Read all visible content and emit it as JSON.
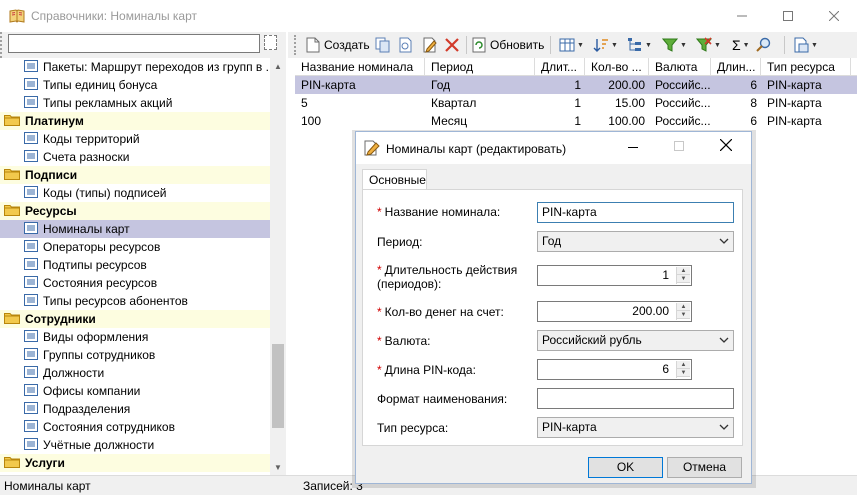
{
  "window": {
    "title": "Справочники: Номиналы карт"
  },
  "filter": {
    "value": ""
  },
  "tree": [
    {
      "kind": "leaf",
      "label": "Пакеты: Маршрут переходов из групп в ..."
    },
    {
      "kind": "leaf",
      "label": "Типы единиц бонуса"
    },
    {
      "kind": "leaf",
      "label": "Типы рекламных акций"
    },
    {
      "kind": "cat",
      "label": "Платинум"
    },
    {
      "kind": "leaf",
      "label": "Коды территорий"
    },
    {
      "kind": "leaf",
      "label": "Счета разноски"
    },
    {
      "kind": "cat",
      "label": "Подписи"
    },
    {
      "kind": "leaf",
      "label": "Коды (типы) подписей"
    },
    {
      "kind": "cat",
      "label": "Ресурсы"
    },
    {
      "kind": "leaf",
      "label": "Номиналы карт",
      "selected": true
    },
    {
      "kind": "leaf",
      "label": "Операторы ресурсов"
    },
    {
      "kind": "leaf",
      "label": "Подтипы ресурсов"
    },
    {
      "kind": "leaf",
      "label": "Состояния ресурсов"
    },
    {
      "kind": "leaf",
      "label": "Типы ресурсов абонентов"
    },
    {
      "kind": "cat",
      "label": "Сотрудники"
    },
    {
      "kind": "leaf",
      "label": "Виды оформления"
    },
    {
      "kind": "leaf",
      "label": "Группы сотрудников"
    },
    {
      "kind": "leaf",
      "label": "Должности"
    },
    {
      "kind": "leaf",
      "label": "Офисы компании"
    },
    {
      "kind": "leaf",
      "label": "Подразделения"
    },
    {
      "kind": "leaf",
      "label": "Состояния сотрудников"
    },
    {
      "kind": "leaf",
      "label": "Учётные должности"
    },
    {
      "kind": "cat",
      "label": "Услуги"
    }
  ],
  "toolbar": {
    "create_label": "Создать",
    "refresh_label": "Обновить",
    "sigma": "Σ"
  },
  "grid": {
    "columns": [
      "Название номинала",
      "Период",
      "Длит...",
      "Кол-во ...",
      "Валюта",
      "Длин...",
      "Тип ресурса"
    ],
    "rows": [
      [
        "PIN-карта",
        "Год",
        "1",
        "200.00",
        "Российс...",
        "6",
        "PIN-карта"
      ],
      [
        "5",
        "Квартал",
        "1",
        "15.00",
        "Российс...",
        "8",
        "PIN-карта"
      ],
      [
        "100",
        "Месяц",
        "1",
        "100.00",
        "Российс...",
        "6",
        "PIN-карта"
      ]
    ]
  },
  "status": {
    "left": "Номиналы карт",
    "records": "Записей: 3"
  },
  "dialog": {
    "title": "Номиналы карт (редактировать)",
    "tab": "Основные",
    "required_mark": "*",
    "fields": {
      "name": {
        "label": "Название номинала:",
        "value": "PIN-карта"
      },
      "period": {
        "label": "Период:",
        "value": "Год"
      },
      "duration": {
        "label": "Длительность действия (периодов):",
        "value": "1"
      },
      "amount": {
        "label": "Кол-во денег на счет:",
        "value": "200.00"
      },
      "currency": {
        "label": "Валюта:",
        "value": "Российский рубль"
      },
      "pin_length": {
        "label": "Длина PIN-кода:",
        "value": "6"
      },
      "name_format": {
        "label": "Формат наименования:",
        "value": ""
      },
      "resource_type": {
        "label": "Тип ресурса:",
        "value": "PIN-карта"
      }
    },
    "ok_label": "OK",
    "cancel_label": "Отмена"
  },
  "colors": {
    "category_bg": "#fdfde0",
    "selection_bg": "#c5c5e0",
    "required": "#d00000"
  }
}
